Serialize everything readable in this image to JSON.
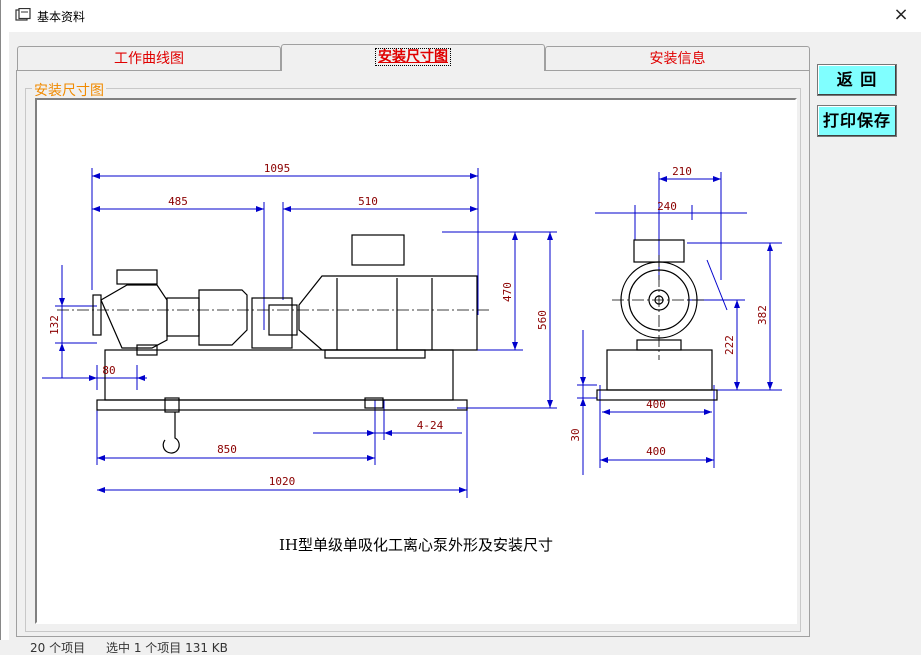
{
  "window": {
    "title": "基本资料",
    "close_glyph": "×"
  },
  "tabs": [
    {
      "label": "工作曲线图",
      "active": false
    },
    {
      "label": "安装尺寸图",
      "active": true
    },
    {
      "label": "安装信息",
      "active": false
    }
  ],
  "groupbox": {
    "legend": "安装尺寸图"
  },
  "drawing": {
    "caption": "IH型单级单吸化工离心泵外形及安装尺寸",
    "dimensions": {
      "overall_length": "1095",
      "pump_to_coupling": "485",
      "motor_length": "510",
      "motor_height": "470",
      "total_height": "560",
      "inlet_height": "132",
      "base_offset": "80",
      "anchor_spacing": "850",
      "base_length": "1020",
      "anchor_holes": "4-24",
      "end_width_top": "210",
      "end_width_mid": "240",
      "centre_height_a": "382",
      "centre_height_b": "222",
      "base_width_inner": "400",
      "base_width_outer": "400",
      "base_thickness": "30"
    }
  },
  "buttons": {
    "return_label": "返 回",
    "print_save_label": "打印保存"
  },
  "background_status": {
    "item_count": "20 个项目",
    "selection": "选中 1 个项目  131 KB"
  },
  "colors": {
    "tab_text": "#e00000",
    "legend_text": "#f08a00",
    "button_bg": "#80ffff",
    "dim_line": "#0000cc",
    "dim_text": "#8b0000"
  }
}
